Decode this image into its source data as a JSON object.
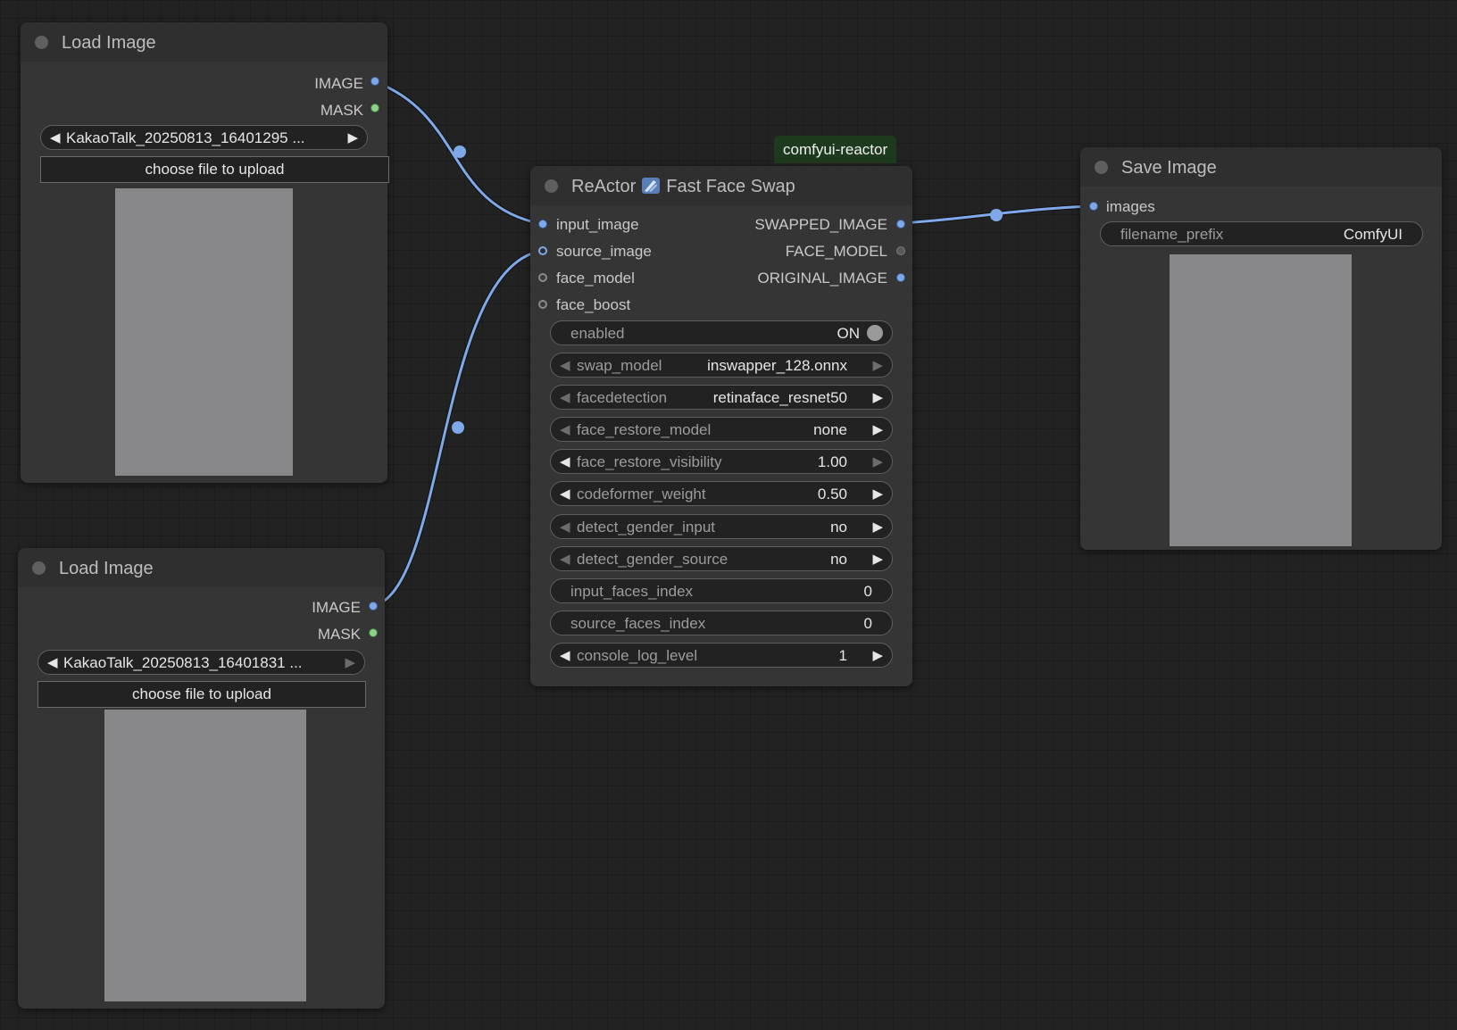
{
  "colors": {
    "wire": "#7fa8e8",
    "canvas": "#222222",
    "node_body": "#353535",
    "node_header": "#2f2f2f",
    "badge": "#1e3a1e"
  },
  "nodes": {
    "load_image_1": {
      "title": "Load Image",
      "outputs": [
        "IMAGE",
        "MASK"
      ],
      "image_value": "KakaoTalk_20250813_16401295 ...",
      "upload_label": "choose file to upload"
    },
    "load_image_2": {
      "title": "Load Image",
      "outputs": [
        "IMAGE",
        "MASK"
      ],
      "image_value": "KakaoTalk_20250813_16401831 ...",
      "upload_label": "choose file to upload"
    },
    "reactor": {
      "badge": "comfyui-reactor",
      "title_left": "ReActor",
      "title_right": "Fast Face Swap",
      "icon": "brush-icon",
      "inputs": [
        "input_image",
        "source_image",
        "face_model",
        "face_boost"
      ],
      "outputs": [
        "SWAPPED_IMAGE",
        "FACE_MODEL",
        "ORIGINAL_IMAGE"
      ],
      "widgets": [
        {
          "label": "enabled",
          "value": "ON"
        },
        {
          "label": "swap_model",
          "value": "inswapper_128.onnx"
        },
        {
          "label": "facedetection",
          "value": "retinaface_resnet50"
        },
        {
          "label": "face_restore_model",
          "value": "none"
        },
        {
          "label": "face_restore_visibility",
          "value": "1.00"
        },
        {
          "label": "codeformer_weight",
          "value": "0.50"
        },
        {
          "label": "detect_gender_input",
          "value": "no"
        },
        {
          "label": "detect_gender_source",
          "value": "no"
        },
        {
          "label": "input_faces_index",
          "value": "0"
        },
        {
          "label": "source_faces_index",
          "value": "0"
        },
        {
          "label": "console_log_level",
          "value": "1"
        }
      ]
    },
    "save_image": {
      "title": "Save Image",
      "inputs": [
        "images"
      ],
      "filename_prefix_label": "filename_prefix",
      "filename_prefix_value": "ComfyUI"
    }
  }
}
